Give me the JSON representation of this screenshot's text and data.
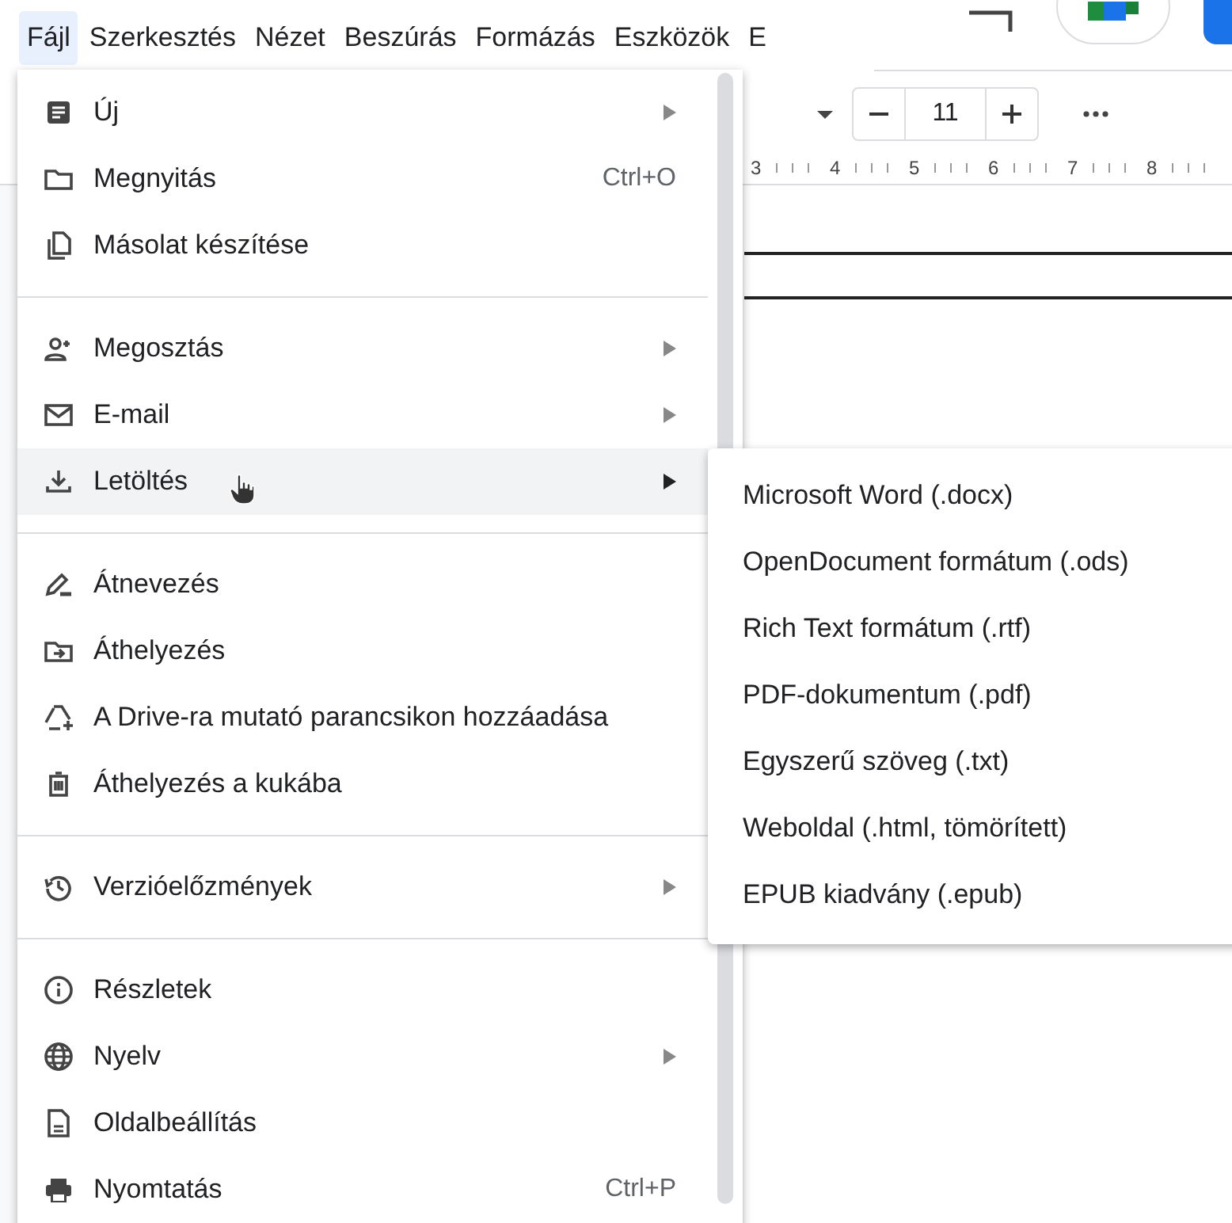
{
  "menubar": [
    {
      "label": "Fájl",
      "selected": true
    },
    {
      "label": "Szerkesztés",
      "selected": false
    },
    {
      "label": "Nézet",
      "selected": false
    },
    {
      "label": "Beszúrás",
      "selected": false
    },
    {
      "label": "Formázás",
      "selected": false
    },
    {
      "label": "Eszközök",
      "selected": false
    },
    {
      "label": "E",
      "selected": false
    }
  ],
  "toolbar": {
    "font_size": "11"
  },
  "ruler": [
    "3",
    "4",
    "5",
    "6",
    "7",
    "8"
  ],
  "file_menu": {
    "sections": [
      [
        {
          "label": "Új",
          "has_submenu": true,
          "selected": false
        },
        {
          "label": "Megnyitás",
          "shortcut": "Ctrl+O",
          "has_submenu": false,
          "selected": false
        },
        {
          "label": "Másolat készítése",
          "has_submenu": false,
          "selected": false
        }
      ],
      [
        {
          "label": "Megosztás",
          "has_submenu": true,
          "selected": false
        },
        {
          "label": "E-mail",
          "has_submenu": true,
          "selected": false
        },
        {
          "label": "Letöltés",
          "has_submenu": true,
          "selected": true
        }
      ],
      [
        {
          "label": "Átnevezés",
          "has_submenu": false,
          "selected": false
        },
        {
          "label": "Áthelyezés",
          "has_submenu": false,
          "selected": false
        },
        {
          "label": "A Drive-ra mutató parancsikon hozzáadása",
          "has_submenu": false,
          "selected": false
        },
        {
          "label": "Áthelyezés a kukába",
          "has_submenu": false,
          "selected": false
        }
      ],
      [
        {
          "label": "Verzióelőzmények",
          "has_submenu": true,
          "selected": false
        }
      ],
      [
        {
          "label": "Részletek",
          "has_submenu": false,
          "selected": false
        },
        {
          "label": "Nyelv",
          "has_submenu": true,
          "selected": false
        },
        {
          "label": "Oldalbeállítás",
          "has_submenu": false,
          "selected": false
        },
        {
          "label": "Nyomtatás",
          "shortcut": "Ctrl+P",
          "has_submenu": false,
          "selected": false
        }
      ]
    ]
  },
  "download_submenu": {
    "items": [
      "Microsoft Word (.docx)",
      "OpenDocument formátum (.ods)",
      "Rich Text formátum (.rtf)",
      "PDF-dokumentum (.pdf)",
      "Egyszerű szöveg (.txt)",
      "Weboldal (.html, tömörített)",
      "EPUB kiadvány (.epub)"
    ]
  }
}
